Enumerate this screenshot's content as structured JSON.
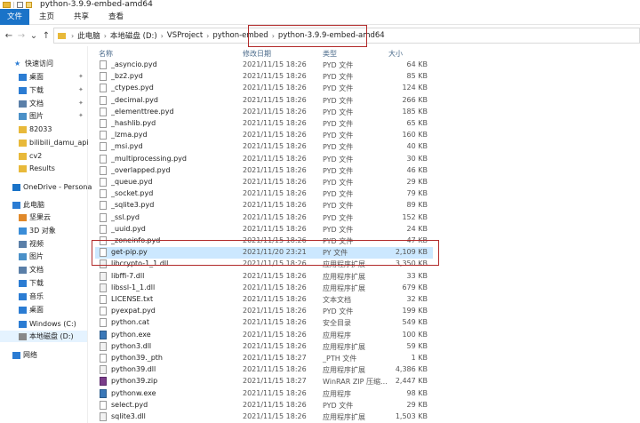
{
  "window": {
    "title": "python-3.9.9-embed-amd64"
  },
  "ribbon": {
    "tabs": [
      "文件",
      "主页",
      "共享",
      "查看"
    ]
  },
  "nav": {
    "back": "←",
    "forward": "→",
    "recent": "⌄",
    "up": "↑",
    "breadcrumbs": [
      "此电脑",
      "本地磁盘 (D:)",
      "VSProject",
      "python-embed",
      "python-3.9.9-embed-amd64"
    ]
  },
  "columns": {
    "name": "名称",
    "date": "修改日期",
    "type": "类型",
    "size": "大小"
  },
  "sidebar": {
    "items": [
      {
        "label": "快速访问",
        "icon": "star-icon",
        "color": "#2b7cd3",
        "pinned": false
      },
      {
        "label": "桌面",
        "icon": "desktop-icon",
        "color": "#2b7cd3",
        "pinned": true
      },
      {
        "label": "下载",
        "icon": "download-icon",
        "color": "#2b7cd3",
        "pinned": true
      },
      {
        "label": "文档",
        "icon": "document-icon",
        "color": "#5a7fa8",
        "pinned": true
      },
      {
        "label": "图片",
        "icon": "picture-icon",
        "color": "#4a90c8",
        "pinned": true
      },
      {
        "label": "82033",
        "icon": "folder-icon",
        "color": "#e8b93a",
        "pinned": false
      },
      {
        "label": "bilibili_damu_api",
        "icon": "folder-icon",
        "color": "#e8b93a",
        "pinned": false
      },
      {
        "label": "cv2",
        "icon": "folder-icon",
        "color": "#e8b93a",
        "pinned": false
      },
      {
        "label": "Results",
        "icon": "folder-icon",
        "color": "#e8b93a",
        "pinned": false
      },
      {
        "label": "OneDrive - Persona",
        "icon": "cloud-icon",
        "color": "#1a73c8",
        "pinned": false
      },
      {
        "label": "此电脑",
        "icon": "computer-icon",
        "color": "#2b7cd3",
        "pinned": false
      },
      {
        "label": "坚果云",
        "icon": "cloud-icon",
        "color": "#e0892a",
        "pinned": false
      },
      {
        "label": "3D 对象",
        "icon": "cube-icon",
        "color": "#3a8dd8",
        "pinned": false
      },
      {
        "label": "视频",
        "icon": "video-icon",
        "color": "#5a7fa8",
        "pinned": false
      },
      {
        "label": "图片",
        "icon": "picture-icon",
        "color": "#4a90c8",
        "pinned": false
      },
      {
        "label": "文档",
        "icon": "document-icon",
        "color": "#5a7fa8",
        "pinned": false
      },
      {
        "label": "下载",
        "icon": "download-icon",
        "color": "#2b7cd3",
        "pinned": false
      },
      {
        "label": "音乐",
        "icon": "music-icon",
        "color": "#2b7cd3",
        "pinned": false
      },
      {
        "label": "桌面",
        "icon": "desktop-icon",
        "color": "#2b7cd3",
        "pinned": false
      },
      {
        "label": "Windows (C:)",
        "icon": "drive-icon",
        "color": "#2b7cd3",
        "pinned": false
      },
      {
        "label": "本地磁盘 (D:)",
        "icon": "drive-icon",
        "color": "#888888",
        "pinned": false
      },
      {
        "label": "网络",
        "icon": "network-icon",
        "color": "#2b7cd3",
        "pinned": false
      }
    ]
  },
  "files": [
    {
      "name": "_asyncio.pyd",
      "date": "2021/11/15 18:26",
      "type": "PYD 文件",
      "size": "64 KB"
    },
    {
      "name": "_bz2.pyd",
      "date": "2021/11/15 18:26",
      "type": "PYD 文件",
      "size": "85 KB"
    },
    {
      "name": "_ctypes.pyd",
      "date": "2021/11/15 18:26",
      "type": "PYD 文件",
      "size": "124 KB"
    },
    {
      "name": "_decimal.pyd",
      "date": "2021/11/15 18:26",
      "type": "PYD 文件",
      "size": "266 KB"
    },
    {
      "name": "_elementtree.pyd",
      "date": "2021/11/15 18:26",
      "type": "PYD 文件",
      "size": "185 KB"
    },
    {
      "name": "_hashlib.pyd",
      "date": "2021/11/15 18:26",
      "type": "PYD 文件",
      "size": "65 KB"
    },
    {
      "name": "_lzma.pyd",
      "date": "2021/11/15 18:26",
      "type": "PYD 文件",
      "size": "160 KB"
    },
    {
      "name": "_msi.pyd",
      "date": "2021/11/15 18:26",
      "type": "PYD 文件",
      "size": "40 KB"
    },
    {
      "name": "_multiprocessing.pyd",
      "date": "2021/11/15 18:26",
      "type": "PYD 文件",
      "size": "30 KB"
    },
    {
      "name": "_overlapped.pyd",
      "date": "2021/11/15 18:26",
      "type": "PYD 文件",
      "size": "46 KB"
    },
    {
      "name": "_queue.pyd",
      "date": "2021/11/15 18:26",
      "type": "PYD 文件",
      "size": "29 KB"
    },
    {
      "name": "_socket.pyd",
      "date": "2021/11/15 18:26",
      "type": "PYD 文件",
      "size": "79 KB"
    },
    {
      "name": "_sqlite3.pyd",
      "date": "2021/11/15 18:26",
      "type": "PYD 文件",
      "size": "89 KB"
    },
    {
      "name": "_ssl.pyd",
      "date": "2021/11/15 18:26",
      "type": "PYD 文件",
      "size": "152 KB"
    },
    {
      "name": "_uuid.pyd",
      "date": "2021/11/15 18:26",
      "type": "PYD 文件",
      "size": "24 KB"
    },
    {
      "name": "_zoneinfo.pyd",
      "date": "2021/11/15 18:26",
      "type": "PYD 文件",
      "size": "47 KB"
    },
    {
      "name": "get-pip.py",
      "date": "2021/11/20 23:21",
      "type": "PY 文件",
      "size": "2,109 KB",
      "selected": true
    },
    {
      "name": "libcrypto-1_1.dll",
      "date": "2021/11/15 18:26",
      "type": "应用程序扩展",
      "size": "3,350 KB"
    },
    {
      "name": "libffi-7.dll",
      "date": "2021/11/15 18:26",
      "type": "应用程序扩展",
      "size": "33 KB"
    },
    {
      "name": "libssl-1_1.dll",
      "date": "2021/11/15 18:26",
      "type": "应用程序扩展",
      "size": "679 KB"
    },
    {
      "name": "LICENSE.txt",
      "date": "2021/11/15 18:26",
      "type": "文本文档",
      "size": "32 KB"
    },
    {
      "name": "pyexpat.pyd",
      "date": "2021/11/15 18:26",
      "type": "PYD 文件",
      "size": "199 KB"
    },
    {
      "name": "python.cat",
      "date": "2021/11/15 18:26",
      "type": "安全目录",
      "size": "549 KB"
    },
    {
      "name": "python.exe",
      "date": "2021/11/15 18:26",
      "type": "应用程序",
      "size": "100 KB"
    },
    {
      "name": "python3.dll",
      "date": "2021/11/15 18:26",
      "type": "应用程序扩展",
      "size": "59 KB"
    },
    {
      "name": "python39._pth",
      "date": "2021/11/15 18:27",
      "type": "_PTH 文件",
      "size": "1 KB"
    },
    {
      "name": "python39.dll",
      "date": "2021/11/15 18:26",
      "type": "应用程序扩展",
      "size": "4,386 KB"
    },
    {
      "name": "python39.zip",
      "date": "2021/11/15 18:27",
      "type": "WinRAR ZIP 压缩...",
      "size": "2,447 KB"
    },
    {
      "name": "pythonw.exe",
      "date": "2021/11/15 18:26",
      "type": "应用程序",
      "size": "98 KB"
    },
    {
      "name": "select.pyd",
      "date": "2021/11/15 18:26",
      "type": "PYD 文件",
      "size": "29 KB"
    },
    {
      "name": "sqlite3.dll",
      "date": "2021/11/15 18:26",
      "type": "应用程序扩展",
      "size": "1,503 KB"
    }
  ]
}
